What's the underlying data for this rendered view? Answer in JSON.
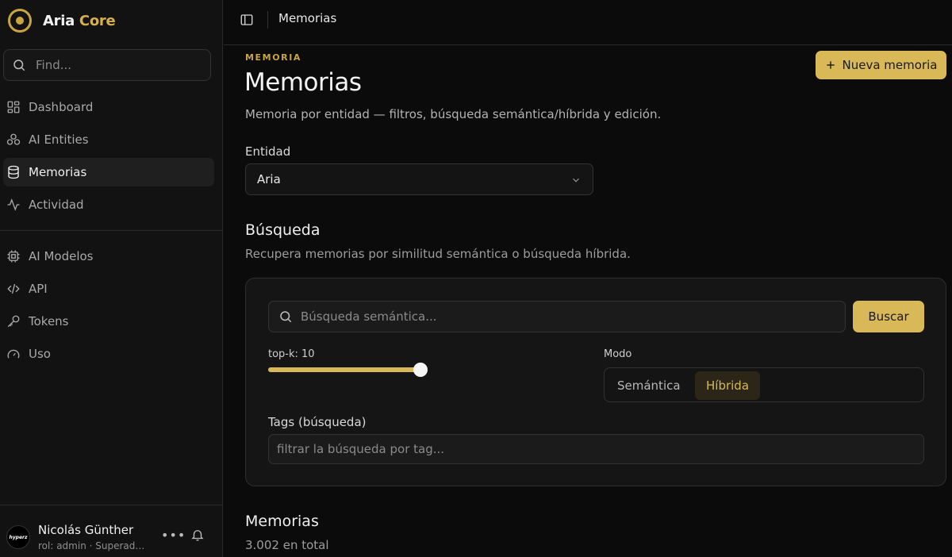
{
  "brand": {
    "name_main": "Aria",
    "name_accent": "Core"
  },
  "sidebar": {
    "search_placeholder": "Find...",
    "items": [
      {
        "label": "Dashboard",
        "icon": "dashboard-icon",
        "active": false
      },
      {
        "label": "AI Entities",
        "icon": "entities-icon",
        "active": false
      },
      {
        "label": "Memorias",
        "icon": "database-icon",
        "active": true
      },
      {
        "label": "Actividad",
        "icon": "activity-icon",
        "active": false
      },
      {
        "label": "AI Modelos",
        "icon": "cpu-icon",
        "active": false
      },
      {
        "label": "API",
        "icon": "code-icon",
        "active": false
      },
      {
        "label": "Tokens",
        "icon": "key-icon",
        "active": false
      },
      {
        "label": "Uso",
        "icon": "gauge-icon",
        "active": false
      }
    ],
    "user": {
      "avatar_text": "hyperz",
      "name": "Nicolás Günther",
      "role": "rol: admin · Superadmin"
    }
  },
  "header": {
    "breadcrumb": "Memorias"
  },
  "page": {
    "eyebrow": "MEMORIA",
    "title": "Memorias",
    "subtitle": "Memoria por entidad — filtros, búsqueda semántica/híbrida y edición.",
    "new_button": "Nueva memoria"
  },
  "entity": {
    "label": "Entidad",
    "value": "Aria"
  },
  "search": {
    "title": "Búsqueda",
    "subtitle": "Recupera memorias por similitud semántica o búsqueda híbrida.",
    "placeholder": "Búsqueda semántica...",
    "button": "Buscar",
    "topk_label": "top-k: 10",
    "topk_fraction": 1.0,
    "mode_label": "Modo",
    "modes": [
      "Semántica",
      "Híbrida"
    ],
    "selected_mode": "Híbrida",
    "tags_label": "Tags (búsqueda)",
    "tags_placeholder": "filtrar la búsqueda por tag..."
  },
  "memories": {
    "title": "Memorias",
    "count": "3.002 en total"
  },
  "colors": {
    "accent": "#d9b857",
    "background": "#0b0b0b"
  }
}
